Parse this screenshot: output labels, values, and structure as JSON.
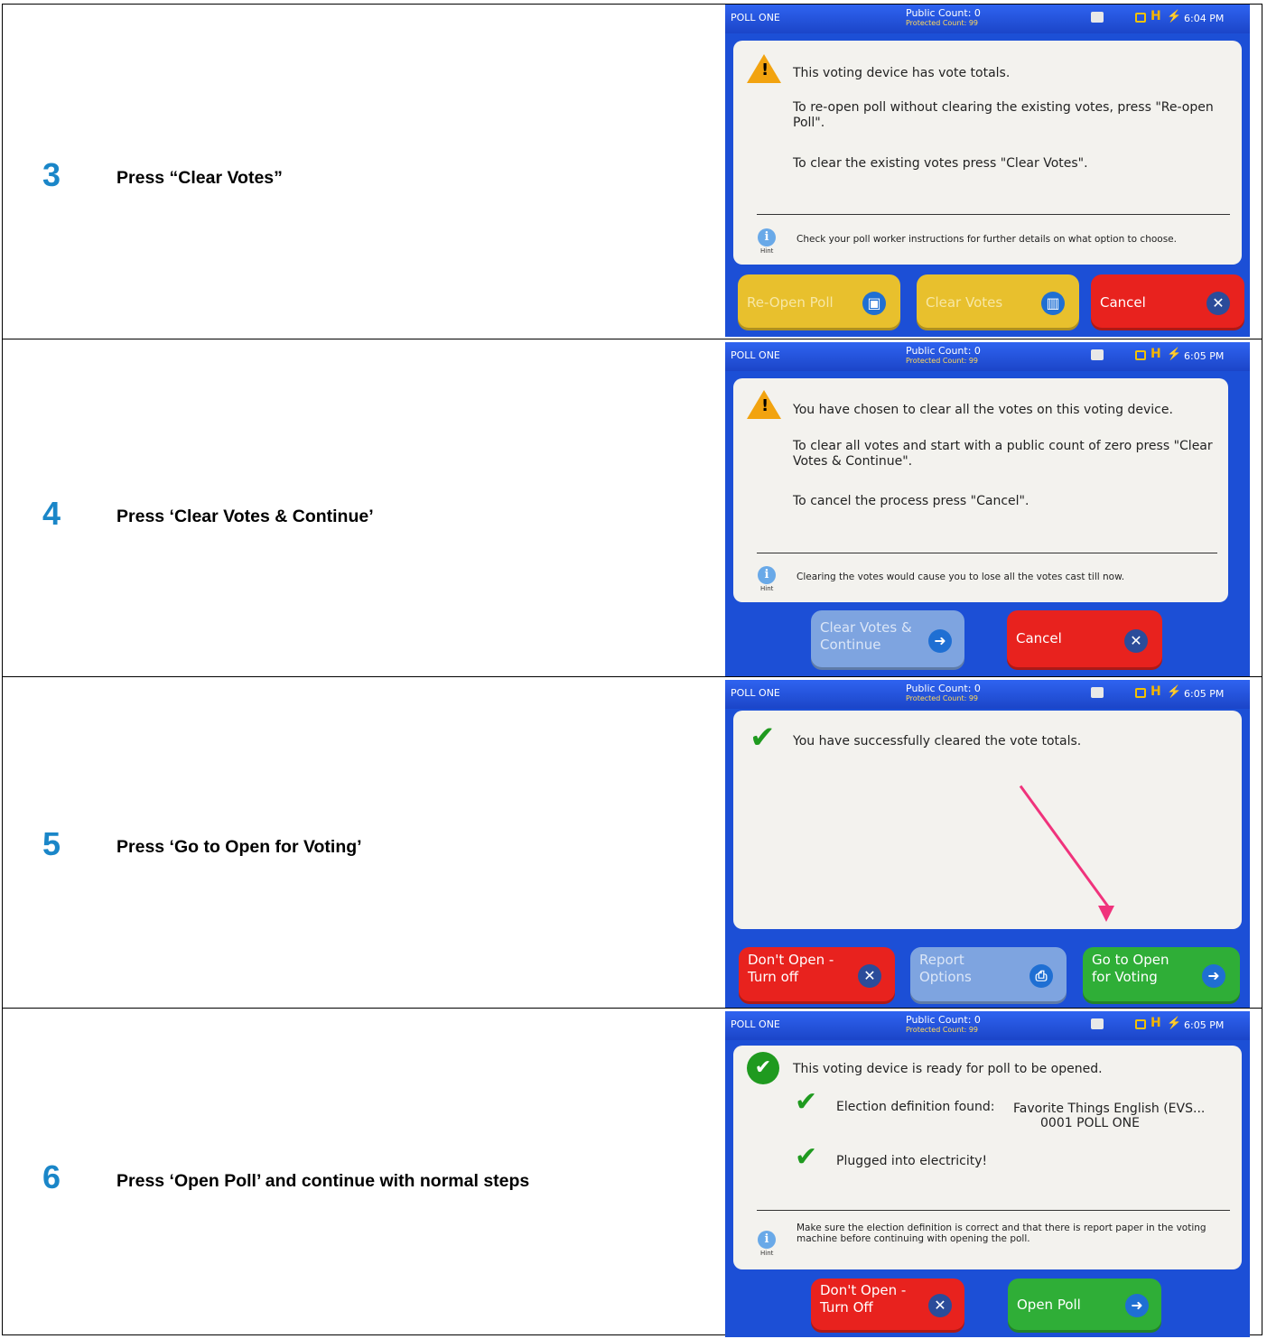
{
  "steps": [
    {
      "number": "3",
      "instruction": "Press “Clear Votes”",
      "screen": {
        "poll": "POLL ONE",
        "public_count": "Public Count: 0",
        "protected_count": "Protected Count: 99",
        "time": "6:04 PM",
        "line1": "This voting device has vote totals.",
        "line2": "To re-open poll without clearing the existing votes, press \"Re-open Poll\".",
        "line3": "To clear the existing votes press \"Clear Votes\".",
        "hint": "Check your poll worker instructions for further details on what option to choose.",
        "hint_label": "Hint",
        "buttons": [
          "Re-Open Poll",
          "Clear Votes",
          "Cancel"
        ]
      }
    },
    {
      "number": "4",
      "instruction": "Press ‘Clear Votes & Continue’",
      "screen": {
        "poll": "POLL ONE",
        "public_count": "Public Count: 0",
        "protected_count": "Protected Count: 99",
        "time": "6:05 PM",
        "line1": "You have chosen to clear all the votes on this voting device.",
        "line2": "To clear all votes and start with a public count of zero press \"Clear Votes & Continue\".",
        "line3": "To cancel the process press \"Cancel\".",
        "hint": "Clearing the votes would cause you to lose all the votes cast till now.",
        "hint_label": "Hint",
        "buttons": [
          "Clear Votes & Continue",
          "Cancel"
        ]
      }
    },
    {
      "number": "5",
      "instruction": "Press ‘Go to Open for Voting’",
      "screen": {
        "poll": "POLL ONE",
        "public_count": "Public Count: 0",
        "protected_count": "Protected Count: 99",
        "time": "6:05 PM",
        "line1": "You have successfully cleared the vote totals.",
        "buttons": [
          "Don't Open - Turn off",
          "Report Options",
          "Go to Open for Voting"
        ]
      }
    },
    {
      "number": "6",
      "instruction": "Press ‘Open Poll’ and continue with normal steps",
      "screen": {
        "poll": "POLL ONE",
        "public_count": "Public Count: 0",
        "protected_count": "Protected Count: 99",
        "time": "6:05 PM",
        "line1": "This voting device is ready for poll to be opened.",
        "election_label": "Election definition found:",
        "election_value": "Favorite Things English (EVS...",
        "election_value2": "0001 POLL ONE",
        "power": "Plugged into electricity!",
        "hint": "Make sure the election definition is correct and that there is report paper in the voting machine before continuing with opening the poll.",
        "hint_label": "Hint",
        "buttons": [
          "Don't Open - Turn Off",
          "Open Poll"
        ]
      }
    }
  ],
  "colors": {
    "step_number": "#1a86c8",
    "screen_bg": "#1c4fd6",
    "cancel_red": "#e8221e",
    "go_green": "#2fae37",
    "pointer_arrow": "#f0337c"
  }
}
